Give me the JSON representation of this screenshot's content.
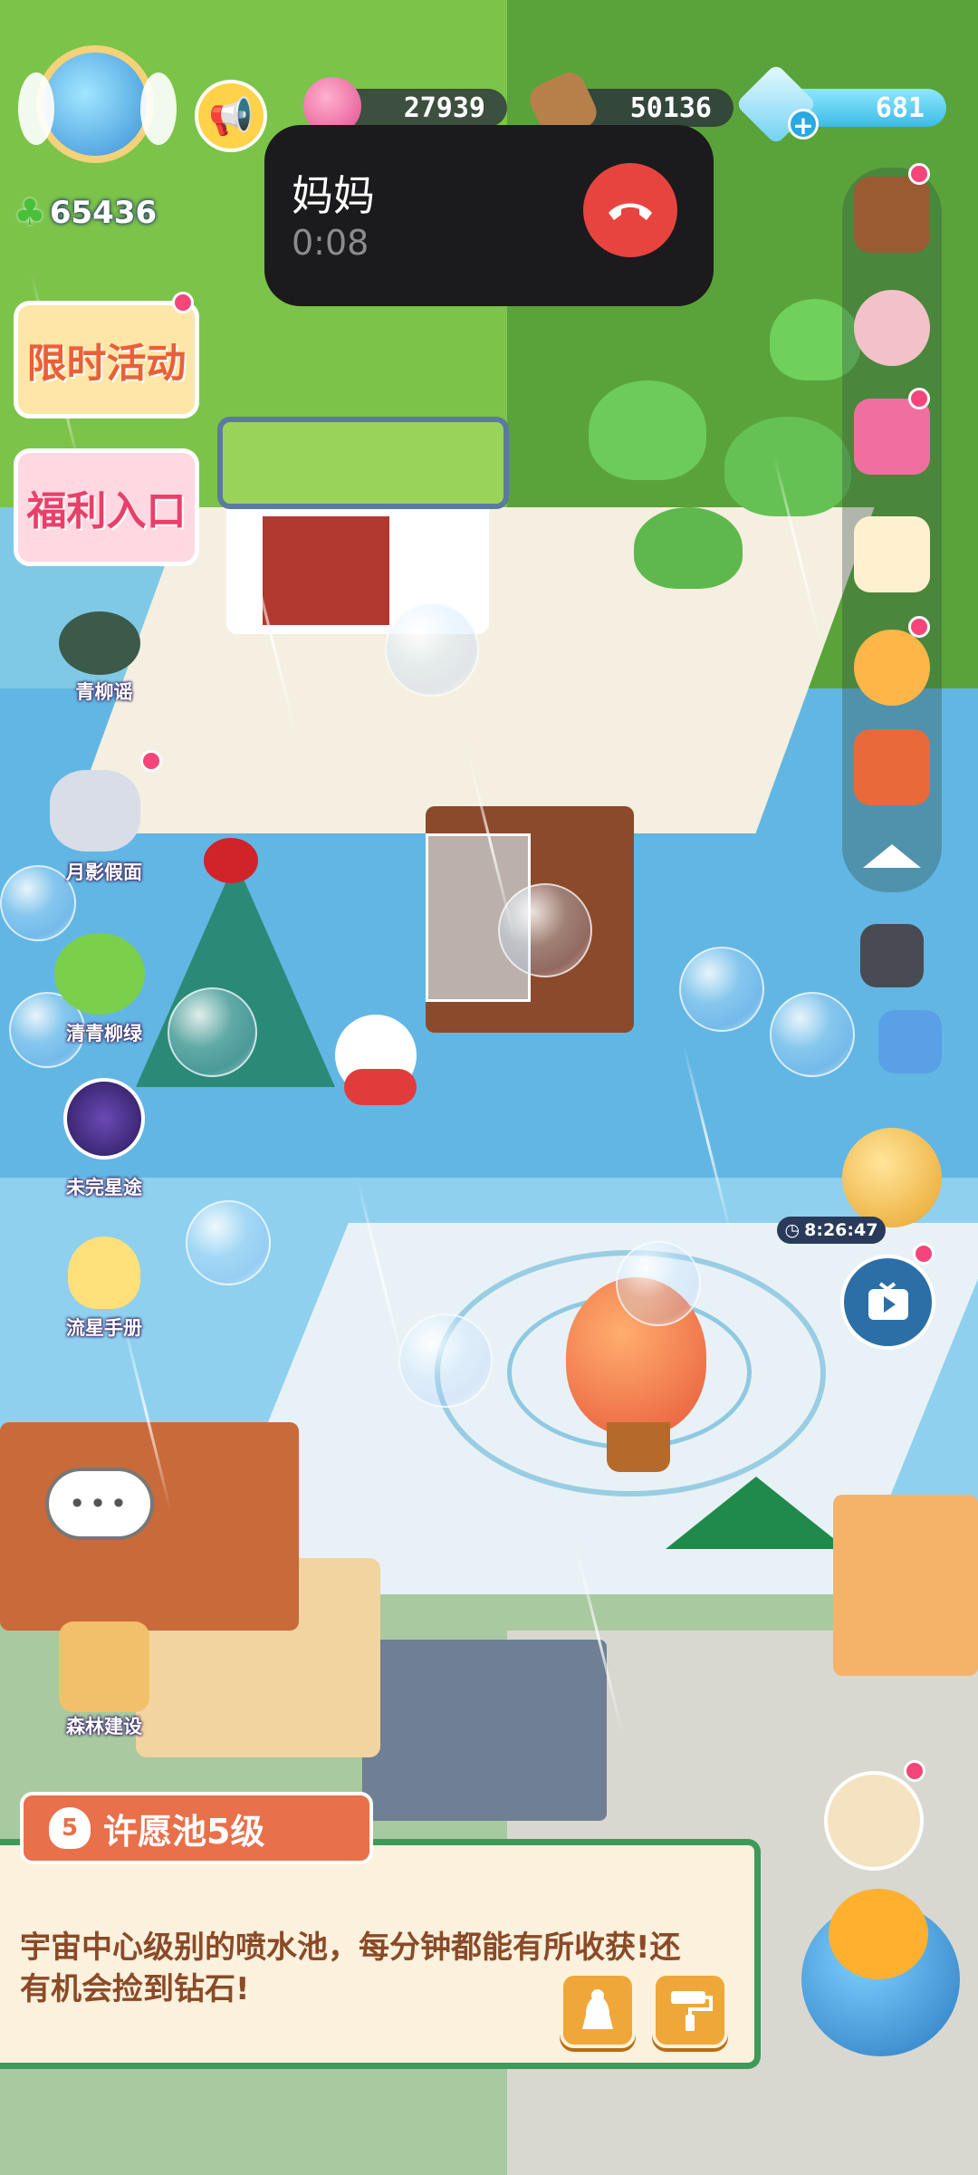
{
  "hud": {
    "clover_count": "65436",
    "resource_1": "27939",
    "resource_2": "50136",
    "diamonds": "681"
  },
  "call_overlay": {
    "caller": "妈妈",
    "duration": "0:08"
  },
  "left_menu": {
    "limited_event": "限时活动",
    "welfare_entry": "福利入口",
    "items": [
      {
        "label": "青柳谣"
      },
      {
        "label": "月影假面"
      },
      {
        "label": "清青柳绿"
      },
      {
        "label": "未完星途"
      },
      {
        "label": "流星手册"
      },
      {
        "label": "森林建设"
      }
    ]
  },
  "right_menu": {
    "timer": "8:26:47"
  },
  "info_panel": {
    "level_number": "5",
    "title": "许愿池5级",
    "description": "宇宙中心级别的喷水池，每分钟都能有所收获!还有机会捡到钻石!"
  },
  "colors": {
    "grass": "#7cc34a",
    "water": "#62b6e3",
    "accent_orange": "#f0a73a",
    "panel_green_border": "#3f9a5a",
    "panel_header_red": "#e8704a",
    "call_bg": "#1b1b1d",
    "hangup_red": "#e8443f",
    "notify_pink": "#f5457a"
  }
}
